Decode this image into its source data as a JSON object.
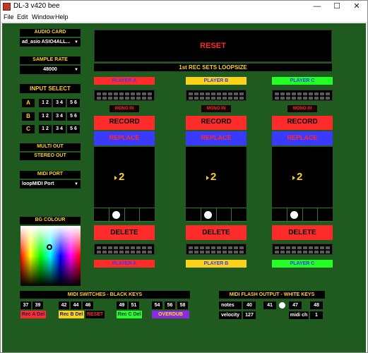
{
  "window": {
    "title": "DL-3 v420 bee",
    "minimize": "—",
    "maximize": "☐",
    "close": "✕"
  },
  "menu": [
    "File",
    "Edit",
    "Window",
    "Help"
  ],
  "left": {
    "audio_card_label": "AUDIO CARD",
    "audio_card_value": "ad_asio ASIO4ALL...",
    "sample_rate_label": "SAMPLE RATE",
    "sample_rate_value": "48000",
    "input_select_label": "INPUT SELECT",
    "input_rows": [
      {
        "letter": "A",
        "options": [
          "1 2",
          "3 4",
          "5 6"
        ]
      },
      {
        "letter": "B",
        "options": [
          "1 2",
          "3 4",
          "5 6"
        ]
      },
      {
        "letter": "C",
        "options": [
          "1 2",
          "3 4",
          "5 6"
        ]
      }
    ],
    "multi_out": "MULTI OUT",
    "stereo_out": "STEREO OUT",
    "midi_port_label": "MIDI PORT",
    "midi_port_value": "loopMIDI Port",
    "bg_colour_label": "BG COLOUR"
  },
  "top": {
    "reset": "RESET",
    "loopsize": "1st REC SETS LOOPSIZE"
  },
  "players": [
    {
      "name": "PLAYER A",
      "head_color": "#ff2b2b",
      "head_text": "#3a3aff",
      "foot_color": "#ff2b2b",
      "foot_text": "#3a3aff",
      "mono": "MONO IN",
      "record": "RECORD",
      "replace": "REPLACE",
      "delete": "DELETE",
      "loop_count": "2"
    },
    {
      "name": "PLAYER B",
      "head_color": "#ffd21a",
      "head_text": "#3a3aff",
      "foot_color": "#ffd21a",
      "foot_text": "#3a3aff",
      "mono": "MONO IN",
      "record": "RECORD",
      "replace": "REPLACE",
      "delete": "DELETE",
      "loop_count": "2"
    },
    {
      "name": "PLAYER C",
      "head_color": "#22ff22",
      "head_text": "#3a3aff",
      "foot_color": "#22ff22",
      "foot_text": "#3a3aff",
      "mono": "MONO IN",
      "record": "RECORD",
      "replace": "REPLACE",
      "delete": "DELETE",
      "loop_count": "2"
    }
  ],
  "midi_switches": {
    "title": "MIDI SWITCHES - BLACK KEYS",
    "groups": [
      {
        "keys": [
          "37",
          "39"
        ],
        "label": "Rec A Del",
        "label_bg": "#ff2b2b",
        "label_fg": "#1a1a6a"
      },
      {
        "keys": [
          "42",
          "44",
          "46"
        ],
        "label": "Rec B Del",
        "label_bg": "#ffd21a",
        "label_fg": "#1a1a6a"
      },
      {
        "reset_label": "RESET"
      },
      {
        "keys": [
          "49",
          "51"
        ],
        "label": "Rec C Del",
        "label_bg": "#22ff22",
        "label_fg": "#1a1a6a"
      },
      {
        "keys": [
          "54",
          "56",
          "58"
        ],
        "label": "OVERDUB",
        "label_bg": "#8a2be2",
        "label_fg": "#ffd21a"
      }
    ]
  },
  "midi_flash": {
    "title": "MIDI FLASH OUTPUT - WHITE KEYS",
    "notes_label": "notes",
    "notes": [
      "40",
      "41",
      "47",
      "48"
    ],
    "velocity_label": "velocity",
    "velocity": "127",
    "midi_ch_label": "midi ch",
    "midi_ch": "1"
  },
  "colors": {
    "stage_bg": "#1f5a1f",
    "panel_black": "#000000",
    "accent_yellow": "#ffd21a",
    "record_red": "#ff2b2b",
    "replace_blue": "#3a3aff"
  }
}
